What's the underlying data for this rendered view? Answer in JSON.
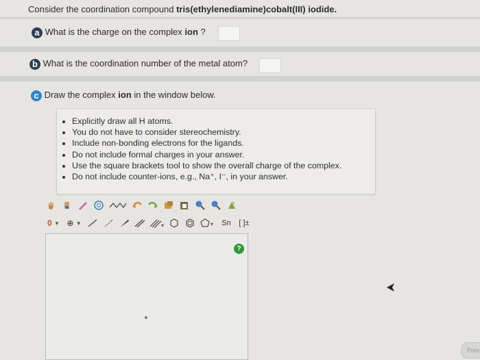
{
  "header": {
    "prefix": "Consider the coordination compound ",
    "compound": "tris(ethylenediamine)cobalt(III) iodide."
  },
  "parts": [
    {
      "badge": "a",
      "prefix": "What is the charge on the complex ",
      "bold": "ion",
      "suffix": " ?",
      "color": "#2c3e54"
    },
    {
      "badge": "b",
      "text": "What is the coordination number of the metal atom?",
      "color": "#2c3e54"
    },
    {
      "badge": "c",
      "prefix": "Draw the complex ",
      "bold": "ion",
      "suffix": " in the window below.",
      "color": "#2d86c6"
    }
  ],
  "instructions": [
    "Explicitly draw all H atoms.",
    "You do not have to consider stereochemistry.",
    "Include non-bonding electrons for the ligands.",
    "Do not include formal charges in your answer.",
    "Use the square brackets tool to show the overall charge of the complex.",
    "Do not include counter-ions, e.g., Na⁺, I⁻, in your answer."
  ],
  "toolbar": {
    "charge_value": "0",
    "plus_symbol": "⊕",
    "icons_row1": [
      "hand-icon",
      "erase-icon",
      "pencil-icon",
      "ring-template-icon",
      "chain-icon",
      "undo-icon",
      "redo-icon",
      "copy-icon",
      "paste-icon",
      "zoom-in-icon",
      "zoom-out-icon",
      "clean-icon"
    ],
    "icons_row2": [
      "single-bond-icon",
      "wedge-bond-icon",
      "double-bond-icon",
      "triple-bond-icon",
      "cyclohexane-icon",
      "benzene-icon",
      "cyclopentane-icon",
      "sn-icon",
      "brackets-icon"
    ],
    "bracket_label": "[ ]±",
    "sn_label": "Sn"
  },
  "help": {
    "label": "?"
  },
  "prev_button": {
    "label": "Previ"
  }
}
